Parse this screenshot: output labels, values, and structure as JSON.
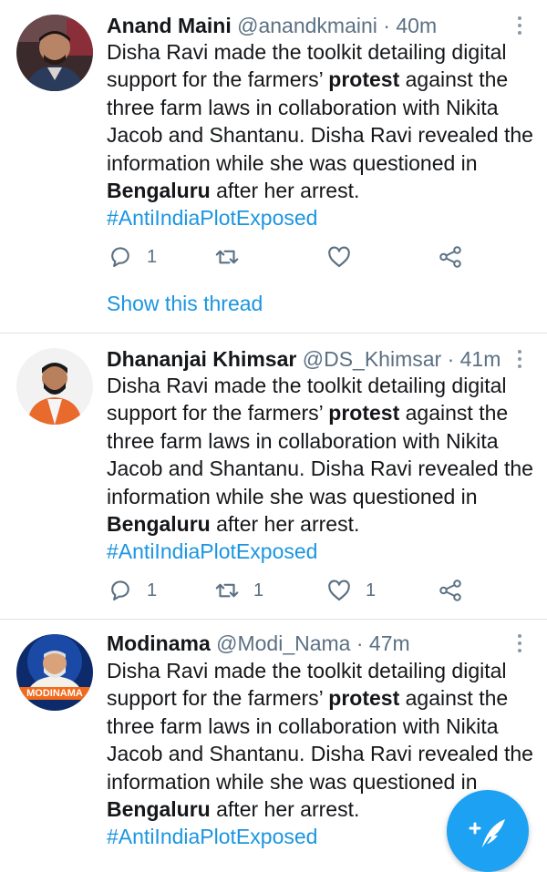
{
  "tweets": [
    {
      "name": "Anand Maini",
      "handle": "@anandkmaini",
      "separator": "·",
      "time": "40m",
      "text_a": "Disha Ravi made the toolkit detailing digital support for the farmers’ ",
      "text_bold1": "protest",
      "text_b": " against the three farm laws in collaboration with Nikita Jacob and Shantanu. Disha Ravi revealed the information while she was questioned in ",
      "text_bold2": "Bengaluru",
      "text_c": " after her arrest.",
      "hashtag": "#AntiIndiaPlotExposed",
      "replies": "1",
      "retweets": "",
      "likes": "",
      "show_thread": "Show this thread"
    },
    {
      "name": "Dhananjai Khimsar",
      "handle": "@DS_Khimsar",
      "separator": "·",
      "time": "41m",
      "text_a": "Disha Ravi made the toolkit detailing digital support for the farmers’ ",
      "text_bold1": "protest",
      "text_b": " against the three farm laws in collaboration with Nikita Jacob and Shantanu. Disha Ravi revealed the information while she was questioned in ",
      "text_bold2": "Bengaluru",
      "text_c": " after her arrest.",
      "hashtag": "#AntiIndiaPlotExposed",
      "replies": "1",
      "retweets": "1",
      "likes": "1"
    },
    {
      "name": "Modinama",
      "handle": "@Modi_Nama",
      "separator": "·",
      "time": "47m",
      "avatar_banner": "MODINAMA",
      "text_a": "Disha Ravi made the toolkit detailing digital support for the farmers’ ",
      "text_bold1": "protest",
      "text_b": " against the three farm laws in collaboration with Nikita Jacob and Shantanu. Disha Ravi revealed the information while she was questioned in ",
      "text_bold2": "Bengaluru",
      "text_c": " after her arrest.",
      "hashtag": "#AntiIndiaPlotExposed"
    }
  ],
  "icons": {
    "reply": "reply-icon",
    "retweet": "retweet-icon",
    "like": "heart-icon",
    "share": "share-icon",
    "more": "more-vertical-icon",
    "compose": "compose-tweet-icon"
  },
  "colors": {
    "link": "#1b95e0",
    "muted": "#5b7083",
    "fab": "#1da1f2",
    "divider": "#dfe3e6"
  }
}
